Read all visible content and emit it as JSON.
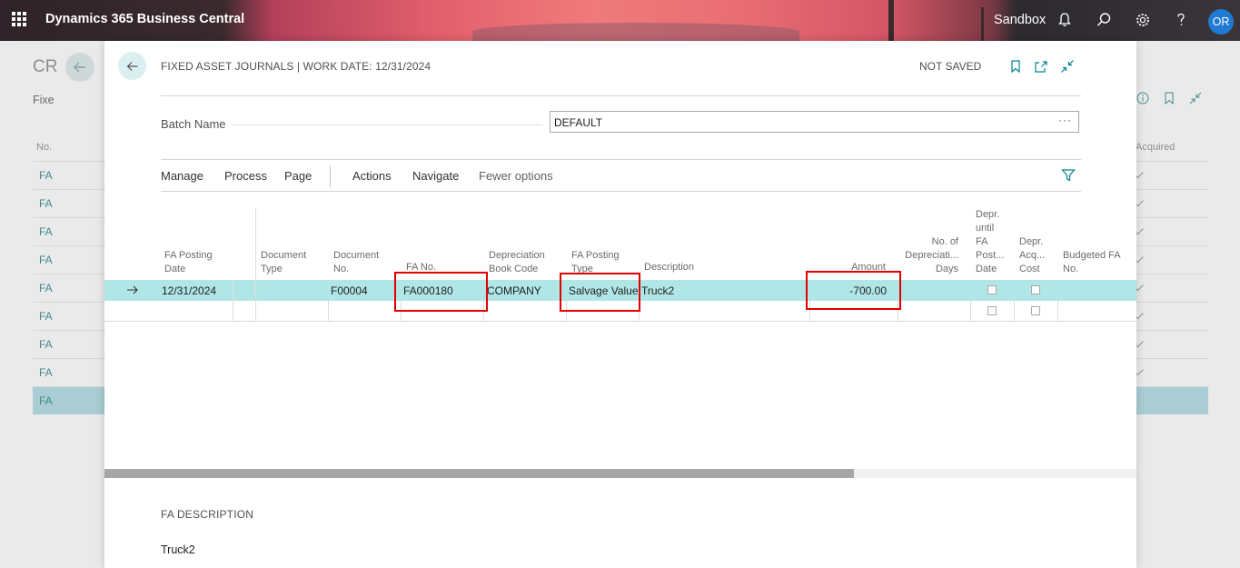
{
  "appbar": {
    "title": "Dynamics 365 Business Central",
    "environment": "Sandbox",
    "avatar_initials": "OR",
    "icons": [
      "app-launcher-icon",
      "bell-icon",
      "search-icon",
      "gear-icon",
      "help-icon"
    ]
  },
  "background_page": {
    "title": "CR",
    "subtitle": "Fixe",
    "col_no": "No.",
    "col_acquired": "Acquired",
    "rows": [
      "FA",
      "FA",
      "FA",
      "FA",
      "FA",
      "FA",
      "FA",
      "FA",
      "FA"
    ]
  },
  "modal": {
    "title": "FIXED ASSET JOURNALS | WORK DATE: 12/31/2024",
    "status": "NOT SAVED",
    "batch_name_label": "Batch Name",
    "batch_name_value": "DEFAULT",
    "batch_more": "···",
    "actions": [
      "Manage",
      "Process",
      "Page",
      "Actions",
      "Navigate",
      "Fewer options"
    ],
    "columns": {
      "fa_posting_date": [
        "FA Posting",
        "Date"
      ],
      "document_type": [
        "Document",
        "Type"
      ],
      "document_no": [
        "Document",
        "No."
      ],
      "fa_no": [
        "FA No."
      ],
      "depreciation_book_code": [
        "Depreciation",
        "Book Code"
      ],
      "fa_posting_type": [
        "FA Posting",
        "Type"
      ],
      "description": [
        "Description"
      ],
      "amount": [
        "Amount"
      ],
      "no_of_depreciation_days": [
        "No. of",
        "Depreciati...",
        "Days"
      ],
      "depr_until_fa_posting_date": [
        "Depr.",
        "until",
        "FA",
        "Post...",
        "Date"
      ],
      "depr_acq_cost": [
        "Depr.",
        "Acq...",
        "Cost"
      ],
      "budgeted_fa_no": [
        "Budgeted FA",
        "No."
      ]
    },
    "row": {
      "fa_posting_date": "12/31/2024",
      "document_type": "",
      "document_no": "F00004",
      "fa_no": "FA000180",
      "depreciation_book_code": "COMPANY",
      "fa_posting_type": "Salvage Value",
      "description": "Truck2",
      "amount": "-700.00",
      "no_of_depreciation_days": "",
      "depr_until_fa_posting_date": false,
      "depr_acq_cost": false,
      "budgeted_fa_no": ""
    },
    "fa_description_label": "FA DESCRIPTION",
    "fa_description_value": "Truck2"
  },
  "colors": {
    "accent": "#00838f",
    "selected_row": "#b0e6e6",
    "highlight_box": "#e00000",
    "avatar": "#1f7ad4"
  }
}
